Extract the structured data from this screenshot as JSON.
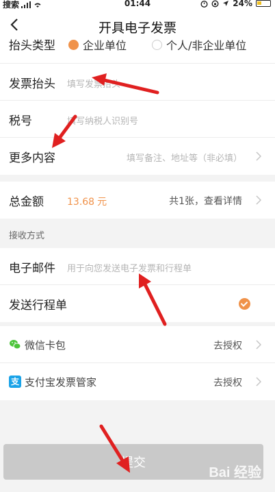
{
  "status_bar": {
    "carrier": "搜索",
    "time": "01:44",
    "battery": "24%"
  },
  "nav": {
    "title": "开具电子发票"
  },
  "invoice": {
    "type_label": "抬头类型",
    "type_option_company": "企业单位",
    "type_option_personal": "个人/非企业单位",
    "title_label": "发票抬头",
    "title_placeholder": "填写发票抬头",
    "tax_label": "税号",
    "tax_placeholder": "填写纳税人识别号",
    "more_label": "更多内容",
    "more_placeholder": "填写备注、地址等（非必填）"
  },
  "amount": {
    "label": "总金额",
    "value": "13.68",
    "unit": "元",
    "detail": "共1张，查看详情"
  },
  "receive": {
    "caption": "接收方式",
    "email_label": "电子邮件",
    "email_placeholder": "用于向您发送电子发票和行程单",
    "itinerary_label": "发送行程单"
  },
  "wallets": [
    {
      "label": "微信卡包",
      "action": "去授权",
      "icon": "wechat-icon"
    },
    {
      "label": "支付宝发票管家",
      "action": "去授权",
      "icon": "alipay-icon",
      "badge": "支"
    }
  ],
  "submit": {
    "label": "提交"
  },
  "watermark": "Bai 经验",
  "colors": {
    "accent": "#f0924a",
    "arrow": "#e02020",
    "alipay": "#1aa3e8",
    "wechat": "#4cc43a"
  }
}
